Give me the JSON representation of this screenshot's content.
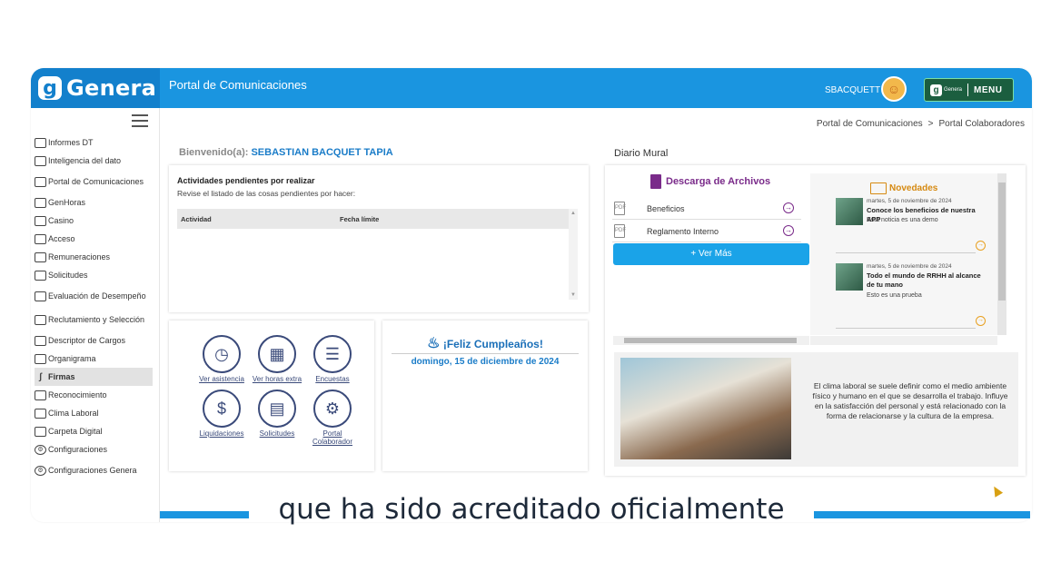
{
  "app": {
    "brand": "Genera",
    "title": "Portal de Comunicaciones",
    "username": "SBACQUETT",
    "menu_brand": "Genera",
    "menu_label": "MENU"
  },
  "sidebar": {
    "items": [
      {
        "label": "Informes DT",
        "icon": "calendar-icon"
      },
      {
        "label": "Inteligencia del dato",
        "icon": "chart-icon"
      },
      {
        "label": "Portal de Comunicaciones",
        "icon": "home-icon"
      },
      {
        "label": "GenHoras",
        "icon": "calendar-grid-icon"
      },
      {
        "label": "Casino",
        "icon": "card-icon"
      },
      {
        "label": "Acceso",
        "icon": "card-icon"
      },
      {
        "label": "Remuneraciones",
        "icon": "money-icon"
      },
      {
        "label": "Solicitudes",
        "icon": "document-icon"
      },
      {
        "label": "Evaluación de Desempeño",
        "icon": "people-chart-icon"
      },
      {
        "label": "Reclutamiento y Selección",
        "icon": "card-icon"
      },
      {
        "label": "Descriptor de Cargos",
        "icon": "card-icon"
      },
      {
        "label": "Organigrama",
        "icon": "card-icon"
      },
      {
        "label": "Firmas",
        "icon": "signature-icon"
      },
      {
        "label": "Reconocimiento",
        "icon": "badge-icon"
      },
      {
        "label": "Clima Laboral",
        "icon": "clipboard-icon"
      },
      {
        "label": "Carpeta Digital",
        "icon": "folder-icon"
      },
      {
        "label": "Configuraciones",
        "icon": "gear-icon"
      },
      {
        "label": "Configuraciones Genera",
        "icon": "gear-icon"
      }
    ],
    "active": "Firmas"
  },
  "breadcrumb": {
    "items": [
      "Portal de Comunicaciones",
      "Portal Colaboradores"
    ],
    "separator": ">"
  },
  "welcome": {
    "prefix": "Bienvenido(a):",
    "name": "SEBASTIAN BACQUET TAPIA"
  },
  "pending": {
    "title": "Actividades pendientes por realizar",
    "subtitle": "Revise el listado de las cosas pendientes por hacer:",
    "columns": [
      "Actividad",
      "Fecha límite"
    ]
  },
  "shortcuts": [
    {
      "label": "Ver asistencia",
      "icon": "clock-screen-icon"
    },
    {
      "label": "Ver horas extra",
      "icon": "calendar-icon"
    },
    {
      "label": "Encuestas",
      "icon": "survey-icon"
    },
    {
      "label": "Liquidaciones",
      "icon": "dollar-arrows-icon"
    },
    {
      "label": "Solicitudes",
      "icon": "document-icon"
    },
    {
      "label": "Portal Colaborador",
      "icon": "badge-gear-icon"
    }
  ],
  "birthday": {
    "title": "¡Feliz Cumpleaños!",
    "date": "domingo, 15 de diciembre de 2024"
  },
  "diario": {
    "title": "Diario Mural",
    "downloads_title": "Descarga de Archivos",
    "files": [
      "Beneficios",
      "Reglamento Interno"
    ],
    "see_more": "+ Ver Más",
    "news_title": "Novedades",
    "news": [
      {
        "date": "martes, 5 de noviembre de 2024",
        "title": "Conoce los beneficios de nuestra APP",
        "desc": "Esta noticia es una demo"
      },
      {
        "date": "martes, 5 de noviembre de 2024",
        "title": "Todo el mundo de RRHH al alcance de tu mano",
        "desc": "Esto es una prueba"
      }
    ],
    "promo_text": "El clima laboral se suele definir como el medio ambiente físico y humano en el que se desarrolla el trabajo. Influye en la satisfacción del personal y está relacionado con la forma de relacionarse y la cultura de la empresa."
  },
  "caption": "que ha sido acreditado oficialmente",
  "colors": {
    "primary": "#1a95e0",
    "accent_purple": "#7a2b8a",
    "accent_orange": "#d68a12",
    "name_blue": "#1a7cc8"
  }
}
